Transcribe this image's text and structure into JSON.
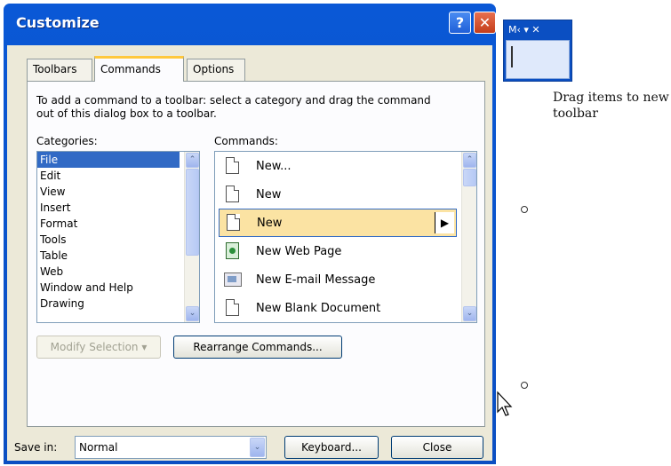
{
  "dialog": {
    "title": "Customize",
    "help_glyph": "?",
    "close_glyph": "✕",
    "tabs": [
      "Toolbars",
      "Commands",
      "Options"
    ],
    "instructions": "To add a command to a toolbar: select a category and drag the command out of this dialog box to a toolbar.",
    "categories_label": "Categories:",
    "commands_label": "Commands:",
    "categories": [
      "File",
      "Edit",
      "View",
      "Insert",
      "Format",
      "Tools",
      "Table",
      "Web",
      "Window and Help",
      "Drawing"
    ],
    "selected_category": "File",
    "commands": [
      {
        "label": "New...",
        "icon": "document-icon"
      },
      {
        "label": "New",
        "icon": "document-icon"
      },
      {
        "label": "New",
        "icon": "document-icon",
        "highlighted": true
      },
      {
        "label": "New Web Page",
        "icon": "web-page-icon"
      },
      {
        "label": "New E-mail Message",
        "icon": "email-icon"
      },
      {
        "label": "New Blank Document",
        "icon": "document-icon"
      }
    ],
    "modify_selection_label": "Modify Selection ▾",
    "rearrange_label": "Rearrange Commands...",
    "save_in_label": "Save in:",
    "save_in_value": "Normal",
    "keyboard_label": "Keyboard...",
    "close_label": "Close",
    "submenu_glyph": "▶",
    "scroll_up_glyph": "⌃",
    "scroll_down_glyph": "⌄",
    "dropdown_glyph": "⌄"
  },
  "mini_toolbar": {
    "title": "M‹ ▾ ✕"
  },
  "note": {
    "text": "Drag items to new toolbar"
  },
  "colors": {
    "titlebar": "#0a58d6",
    "dialog_face": "#ece9d8",
    "selection": "#316ac5",
    "highlight": "#fbe3a3",
    "active_tab_accent": "#ffc83c"
  }
}
